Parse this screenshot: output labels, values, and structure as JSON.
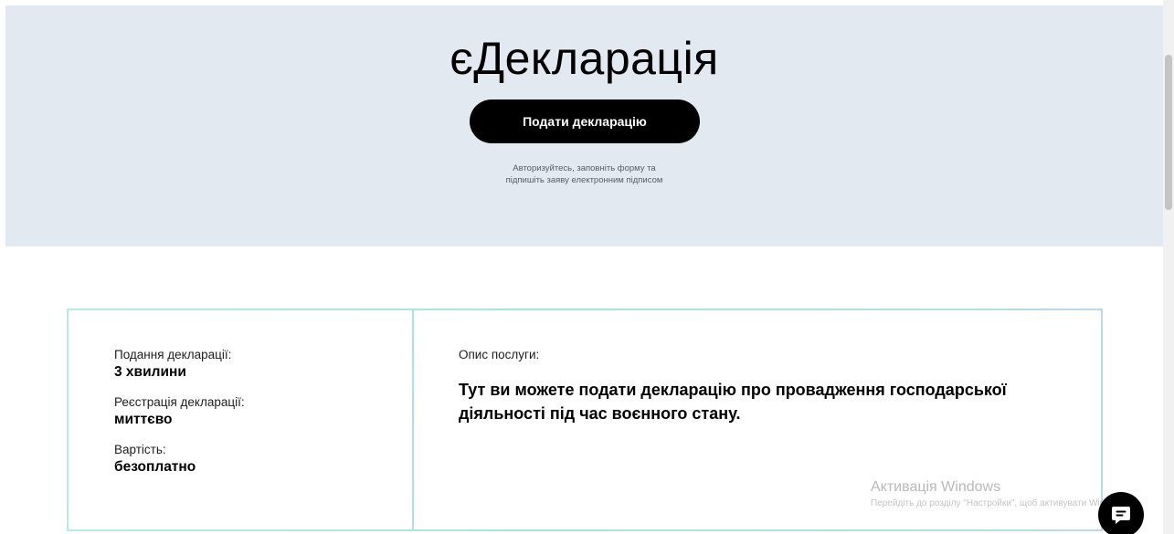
{
  "hero": {
    "title": "єДекларація",
    "cta_label": "Подати декларацію",
    "hint": "Авторизуйтесь, заповніть форму та\nпідпишіть заяву електронним підписом"
  },
  "info": {
    "facts": [
      {
        "label": "Подання декларації:",
        "value": "3 хвилини"
      },
      {
        "label": "Реєстрація декларації:",
        "value": "миттєво"
      },
      {
        "label": "Вартість:",
        "value": "безоплатно"
      }
    ],
    "description_label": "Опис послуги:",
    "description": "Тут ви можете подати декларацію про провадження господарської діяльності під час воєнного стану."
  },
  "watermark": {
    "title": "Активація Windows",
    "subtitle": "Перейдіть до розділу \"Настройки\", щоб активувати Windows."
  },
  "chat_button": {
    "icon": "chat-icon",
    "color": "#000000"
  },
  "colors": {
    "hero_background": "#e2e9f1",
    "card_border": "#a8e4d8",
    "primary": "#000000"
  }
}
